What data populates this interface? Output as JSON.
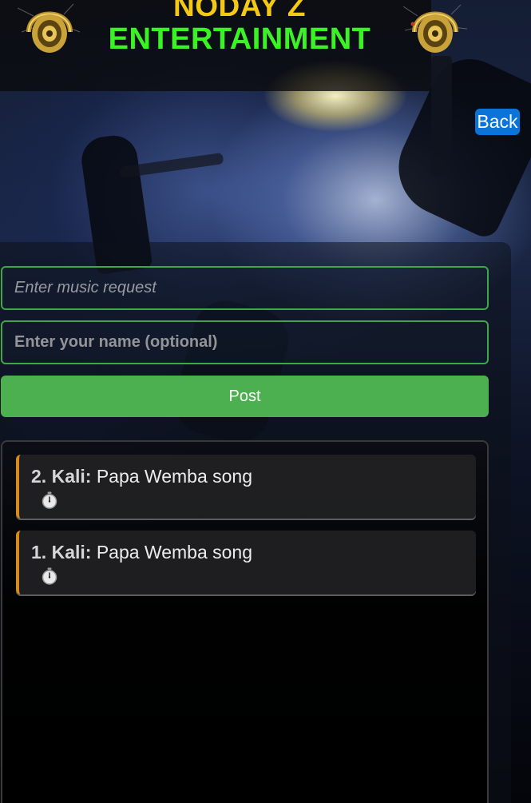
{
  "header": {
    "title_line1": "NODAY Z",
    "title_line2": "ENTERTAINMENT",
    "logo_icon": "headphones-icon"
  },
  "nav": {
    "back_label": "Back"
  },
  "form": {
    "request_placeholder": "Enter music request",
    "name_placeholder": "Enter your name (optional)",
    "post_label": "Post"
  },
  "requests": [
    {
      "number": "2.",
      "name": "Kali:",
      "song": "Papa Wemba song",
      "icon": "stopwatch-icon"
    },
    {
      "number": "1.",
      "name": "Kali:",
      "song": "Papa Wemba song",
      "icon": "stopwatch-icon"
    }
  ],
  "colors": {
    "title_yellow": "#f3c913",
    "title_green": "#3bf227",
    "accent_green": "#4caf50",
    "back_blue": "#0b74d9",
    "card_border": "#d88a1a"
  }
}
